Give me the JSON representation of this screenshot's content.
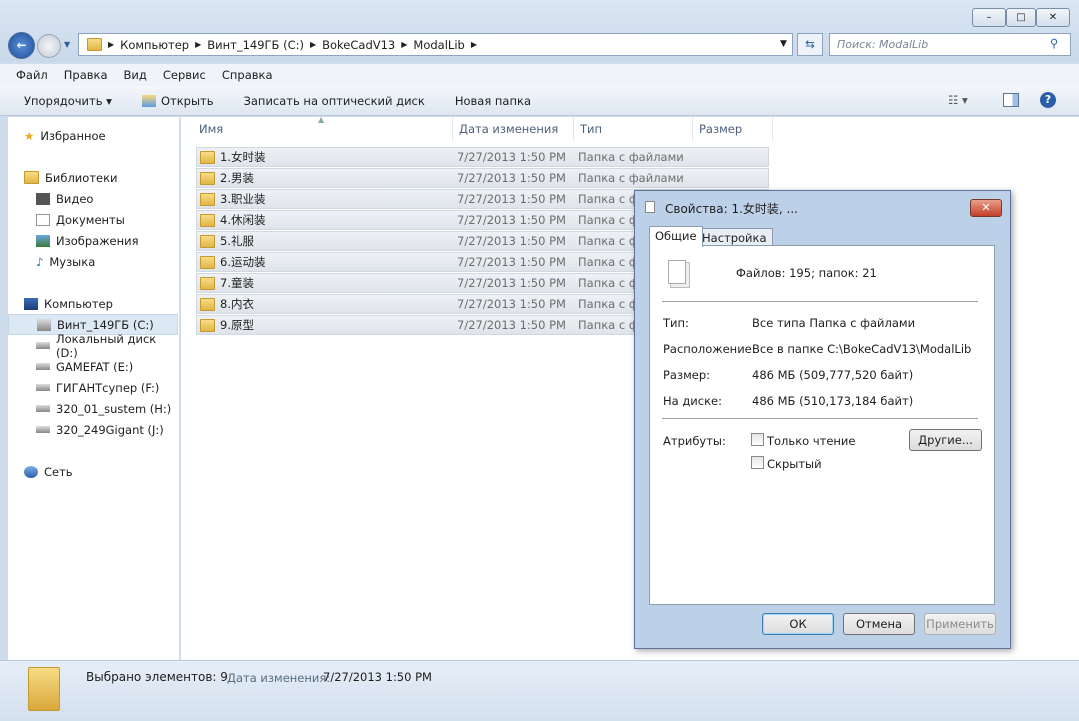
{
  "window": {
    "minimize": "–",
    "maximize": "□",
    "close": "✕"
  },
  "address": {
    "crumbs": [
      "Компьютер",
      "Винт_149ГБ (C:)",
      "BokeCadV13",
      "ModalLib"
    ],
    "search_placeholder": "Поиск: ModalLib"
  },
  "menu": [
    "Файл",
    "Правка",
    "Вид",
    "Сервис",
    "Справка"
  ],
  "toolbar": {
    "organize": "Упорядочить ▾",
    "open": "Открыть",
    "burn": "Записать на оптический диск",
    "new_folder": "Новая папка"
  },
  "sidebar": {
    "favorites": "Избранное",
    "libraries": "Библиотеки",
    "lib_items": [
      "Видео",
      "Документы",
      "Изображения",
      "Музыка"
    ],
    "computer": "Компьютер",
    "drives": [
      "Винт_149ГБ (C:)",
      "Локальный диск (D:)",
      "GAMEFAT (E:)",
      "ГИГАНТсупер (F:)",
      "320_01_sustem (H:)",
      "320_249Gigant (J:)"
    ],
    "network": "Сеть"
  },
  "columns": {
    "name": "Имя",
    "date": "Дата изменения",
    "type": "Тип",
    "size": "Размер"
  },
  "files": [
    {
      "name": "1.女时装",
      "date": "7/27/2013 1:50 PM",
      "type": "Папка с файлами"
    },
    {
      "name": "2.男装",
      "date": "7/27/2013 1:50 PM",
      "type": "Папка с файлами"
    },
    {
      "name": "3.职业装",
      "date": "7/27/2013 1:50 PM",
      "type": "Папка с ф"
    },
    {
      "name": "4.休闲装",
      "date": "7/27/2013 1:50 PM",
      "type": "Папка с ф"
    },
    {
      "name": "5.礼服",
      "date": "7/27/2013 1:50 PM",
      "type": "Папка с ф"
    },
    {
      "name": "6.运动装",
      "date": "7/27/2013 1:50 PM",
      "type": "Папка с ф"
    },
    {
      "name": "7.童装",
      "date": "7/27/2013 1:50 PM",
      "type": "Папка с ф"
    },
    {
      "name": "8.内衣",
      "date": "7/27/2013 1:50 PM",
      "type": "Папка с ф"
    },
    {
      "name": "9.原型",
      "date": "7/27/2013 1:50 PM",
      "type": "Папка с ф"
    }
  ],
  "status": {
    "selected": "Выбрано элементов: 9",
    "date_label": "Дата изменения:",
    "date": "7/27/2013 1:50 PM"
  },
  "dialog": {
    "title": "Свойства: 1.女时装, ...",
    "close": "✕",
    "tabs": [
      "Общие",
      "Настройка"
    ],
    "summary": "Файлов: 195; папок: 21",
    "type_label": "Тип:",
    "type": "Все типа Папка с файлами",
    "location_label": "Расположение:",
    "location": "Все в папке C:\\BokeCadV13\\ModalLib",
    "size_label": "Размер:",
    "size": "486 МБ (509,777,520 байт)",
    "disk_label": "На диске:",
    "disk": "486 МБ (510,173,184 байт)",
    "attr_label": "Атрибуты:",
    "readonly": "Только чтение",
    "hidden": "Скрытый",
    "other": "Другие...",
    "ok": "ОК",
    "cancel": "Отмена",
    "apply": "Применить"
  }
}
